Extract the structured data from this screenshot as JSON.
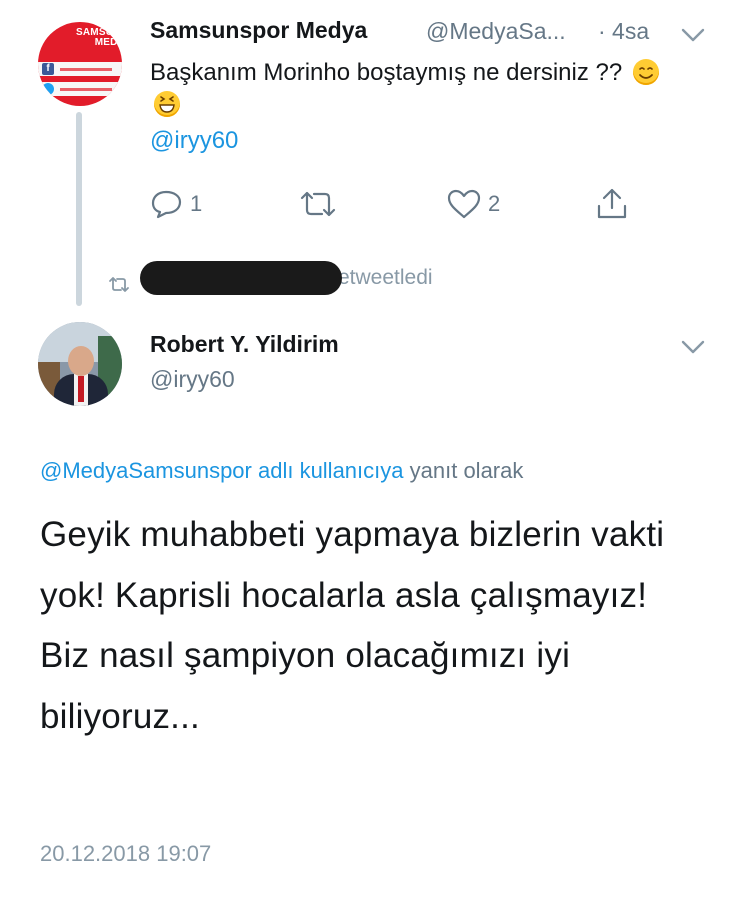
{
  "parent_tweet": {
    "display_name": "Samsunspor Medya",
    "handle": "@MedyaSa...",
    "time": "· 4sa",
    "text": "Başkanım Morinho boştaymış ne dersiniz ??",
    "mention": "@iryy60",
    "avatar_logo_lines": [
      "SAMSUNSPOR",
      "MEDYA"
    ],
    "actions": {
      "reply_count": "1",
      "retweet_count": "",
      "like_count": "2"
    }
  },
  "retweet_banner": {
    "label": "etweetledi"
  },
  "main_tweet": {
    "display_name": "Robert Y. Yildirim",
    "handle": "@iryy60",
    "reply_to_mention": "@MedyaSamsunspor adlı kullanıcıya",
    "reply_to_suffix": "yanıt olarak",
    "text": "Geyik muhabbeti yapmaya bizlerin vakti yok! Kaprisli hocalarla asla çalışmayız! Biz nasıl şampiyon olacağımızı iyi biliyoruz...",
    "timestamp": "20.12.2018 19:07"
  },
  "colors": {
    "link": "#1b95e0",
    "secondary_text": "#657786",
    "icon_gray": "#657786",
    "thread_line": "#ccd6dd",
    "avatar_red": "#e21c2a"
  },
  "icons": {
    "reply": "speech-bubble-icon",
    "retweet": "retweet-arrows-icon",
    "like": "heart-outline-icon",
    "share": "share-upload-icon",
    "more": "chevron-down-icon"
  }
}
